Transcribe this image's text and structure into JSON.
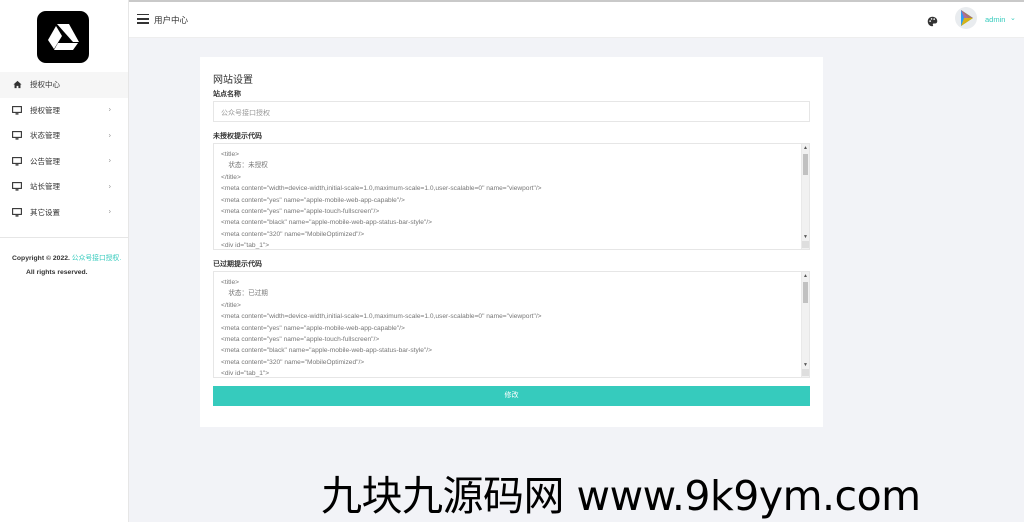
{
  "header": {
    "title": "用户中心",
    "user_name": "admin"
  },
  "sidebar": {
    "items": [
      {
        "label": "授权中心",
        "icon": "home-icon",
        "active": true
      },
      {
        "label": "授权管理",
        "icon": "monitor-icon"
      },
      {
        "label": "状态管理",
        "icon": "monitor-icon"
      },
      {
        "label": "公告管理",
        "icon": "monitor-icon"
      },
      {
        "label": "站长管理",
        "icon": "monitor-icon"
      },
      {
        "label": "其它设置",
        "icon": "monitor-icon"
      }
    ],
    "copyright_prefix": "Copyright © 2022.",
    "copyright_link": "公众号接口授权.",
    "copyright_suffix": "All rights reserved."
  },
  "form": {
    "title": "网站设置",
    "site_name_label": "站点名称",
    "site_name_value": "公众号接口授权",
    "unauth_label": "未授权提示代码",
    "unauth_lines": [
      "<title>",
      "    状态：未授权",
      "</title>",
      "<meta content=\"width=device-width,initial-scale=1.0,maximum-scale=1.0,user-scalable=0\" name=\"viewport\"/>",
      "<meta content=\"yes\" name=\"apple-mobile-web-app-capable\"/>",
      "<meta content=\"yes\" name=\"apple-touch-fullscreen\"/>",
      "<meta content=\"black\" name=\"apple-mobile-web-app-status-bar-style\"/>",
      "<meta content=\"320\" name=\"MobileOptimized\"/>",
      "<div id=\"tab_1\">"
    ],
    "expired_label": "已过期提示代码",
    "expired_lines": [
      "<title>",
      "    状态：已过期",
      "</title>",
      "<meta content=\"width=device-width,initial-scale=1.0,maximum-scale=1.0,user-scalable=0\" name=\"viewport\"/>",
      "<meta content=\"yes\" name=\"apple-mobile-web-app-capable\"/>",
      "<meta content=\"yes\" name=\"apple-touch-fullscreen\"/>",
      "<meta content=\"black\" name=\"apple-mobile-web-app-status-bar-style\"/>",
      "<meta content=\"320\" name=\"MobileOptimized\"/>",
      "<div id=\"tab_1\">"
    ],
    "submit_label": "修改"
  },
  "watermark": "九块九源码网 www.9k9ym.com",
  "colors": {
    "accent": "#36cbbd",
    "background": "#f2f3f7"
  }
}
